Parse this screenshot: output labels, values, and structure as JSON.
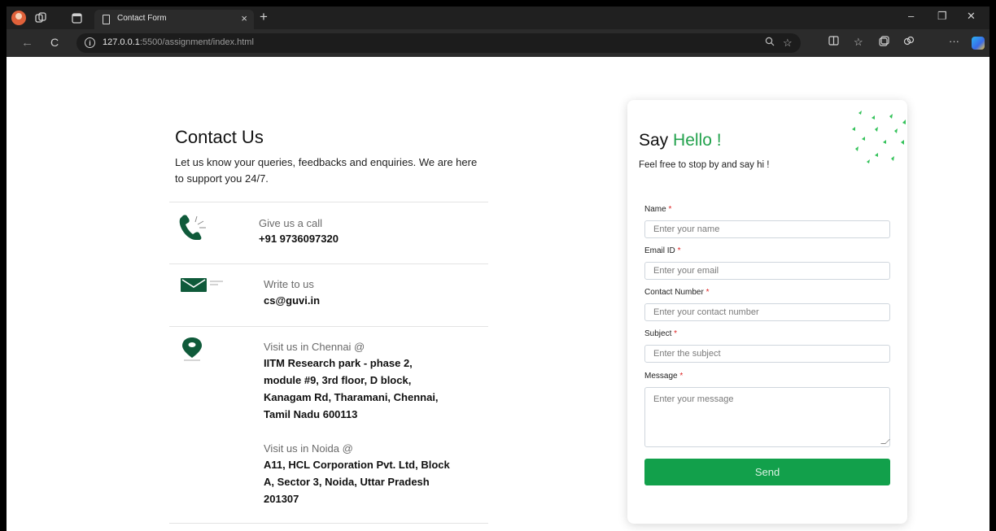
{
  "browser": {
    "tab_title": "Contact Form",
    "tab_close": "×",
    "new_tab": "+",
    "url_host": "127.0.0.1",
    "url_rest": ":5500/assignment/index.html",
    "window_controls": {
      "minimize": "–",
      "restore": "❐",
      "close": "✕"
    },
    "nav": {
      "back": "←",
      "reload": "C"
    },
    "icons": [
      "profile-icon",
      "workspaces-icon",
      "tab-actions-icon",
      "zoom-icon",
      "favorite-icon",
      "split-screen-icon",
      "favorites-icon",
      "collections-icon",
      "extensions-icon",
      "more-icon",
      "copilot-icon"
    ],
    "more_label": "···"
  },
  "contact": {
    "title": "Contact Us",
    "lead": "Let us know your queries, feedbacks and enquiries. We are here to support you 24/7.",
    "call": {
      "label": "Give us a call",
      "value": "+91 9736097320"
    },
    "email": {
      "label": "Write to us",
      "value": "cs@guvi.in"
    },
    "chennai": {
      "label": "Visit us in Chennai @",
      "value": "IITM Research park - phase 2, module #9, 3rd floor, D block, Kanagam Rd, Tharamani, Chennai, Tamil Nadu 600113"
    },
    "noida": {
      "label": "Visit us in Noida @",
      "value": "A11, HCL Corporation Pvt. Ltd, Block A, Sector 3, Noida, Uttar Pradesh 201307"
    }
  },
  "form": {
    "say": "Say",
    "hello": "Hello !",
    "subtitle": "Feel free to stop by and say hi !",
    "required_mark": "*",
    "fields": {
      "name": {
        "label": "Name",
        "placeholder": "Enter your name"
      },
      "email": {
        "label": "Email ID",
        "placeholder": "Enter your email"
      },
      "contact": {
        "label": "Contact Number",
        "placeholder": "Enter your contact number"
      },
      "subject": {
        "label": "Subject",
        "placeholder": "Enter the subject"
      },
      "message": {
        "label": "Message",
        "placeholder": "Enter your message"
      }
    },
    "submit": "Send"
  },
  "colors": {
    "accent": "#23a24d",
    "button": "#12a04b",
    "icon": "#0f5a3a",
    "required": "#dd2222"
  }
}
